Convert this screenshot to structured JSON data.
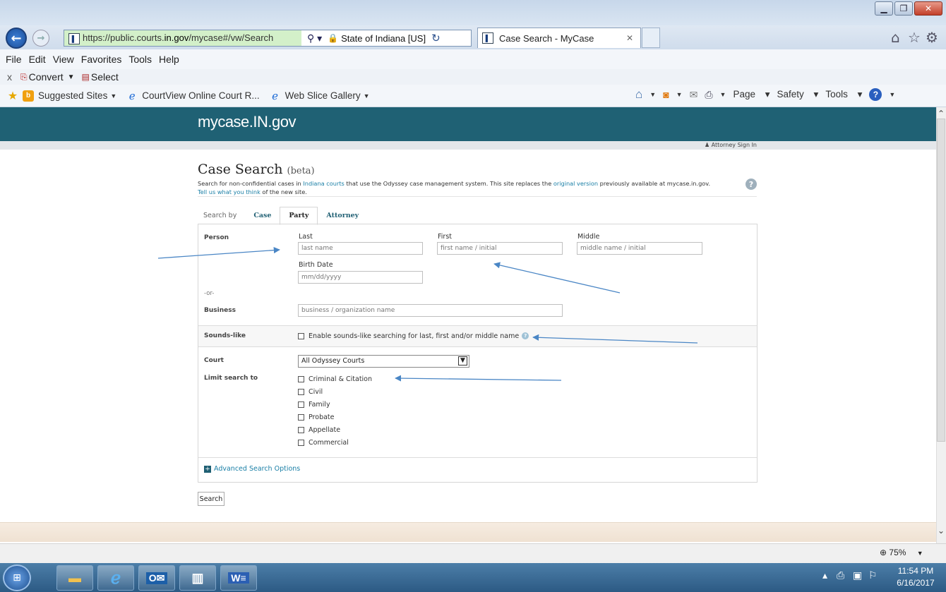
{
  "browser": {
    "address": {
      "prefix": "https://public.courts.",
      "domain": "in.gov",
      "path": "/mycase#/vw/Search"
    },
    "site_identity": "State of Indiana [US]",
    "tab_title": "Case Search - MyCase",
    "menu": [
      "File",
      "Edit",
      "View",
      "Favorites",
      "Tools",
      "Help"
    ],
    "convert_bar": {
      "close": "x",
      "convert": "Convert",
      "select": "Select"
    },
    "favorites": [
      "Suggested Sites",
      "CourtView Online Court R...",
      "Web Slice Gallery"
    ],
    "command_bar": [
      "Page",
      "Safety",
      "Tools"
    ],
    "zoom": "75%"
  },
  "site": {
    "logo": "mycase.IN.gov",
    "attorney_signin": "Attorney Sign In",
    "title": "Case Search",
    "title_suffix": "(beta)",
    "desc": {
      "p1": "Search for non-confidential cases in ",
      "link1": "Indiana courts",
      "p2": " that use the Odyssey case management system. This site replaces the ",
      "link2": "original version",
      "p3": " previously available at mycase.in.gov.",
      "link3": "Tell us what you think",
      "p4": " of the new site."
    },
    "tabs": {
      "label": "Search by",
      "case": "Case",
      "party": "Party",
      "attorney": "Attorney"
    },
    "person": {
      "label": "Person",
      "last_label": "Last",
      "last_placeholder": "last name",
      "first_label": "First",
      "first_placeholder": "first name / initial",
      "middle_label": "Middle",
      "middle_placeholder": "middle name / initial",
      "birth_label": "Birth Date",
      "birth_placeholder": "mm/dd/yyyy"
    },
    "or_label": "-or-",
    "business": {
      "label": "Business",
      "placeholder": "business / organization name"
    },
    "sounds_like": {
      "label": "Sounds-like",
      "option": "Enable sounds-like searching for last, first and/or middle name"
    },
    "court": {
      "label": "Court",
      "selected": "All Odyssey Courts"
    },
    "limit": {
      "label": "Limit search to",
      "options": [
        "Criminal & Citation",
        "Civil",
        "Family",
        "Probate",
        "Appellate",
        "Commercial"
      ]
    },
    "advanced": "Advanced Search Options",
    "search_button": "Search"
  },
  "taskbar": {
    "time": "11:54 PM",
    "date": "6/16/2017"
  }
}
